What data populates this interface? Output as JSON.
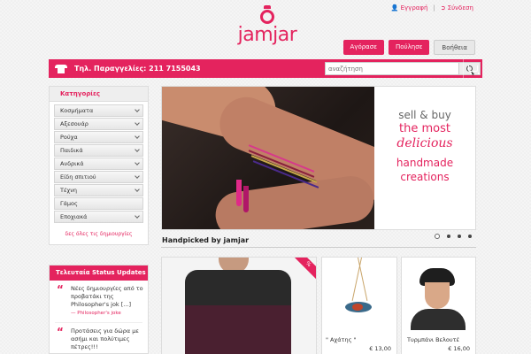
{
  "header": {
    "register": "Εγγραφή",
    "login": "Σύνδεση",
    "brand": "jamjar",
    "buttons": {
      "buy": "Αγόρασε",
      "sell": "Πούλησε",
      "help": "Βοήθεια"
    }
  },
  "bar": {
    "phone_text": "Τηλ. Παραγγελίες: 211 7155043",
    "search_placeholder": "αναζήτηση"
  },
  "sidebar": {
    "title": "Κατηγορίες",
    "items": [
      "Κοσμήματα",
      "Αξεσουάρ",
      "Ρούχα",
      "Παιδικά",
      "Ανδρικά",
      "Είδη σπιτιού",
      "Τέχνη",
      "Γάμος",
      "Εποχιακά"
    ],
    "see_all": "δες όλες τις δημιουργίες"
  },
  "status": {
    "title": "Τελευταία Status Updates",
    "updates": [
      {
        "text": "Νέες δημιουργίες από το προβατάκι της Philosopher's jok [...]",
        "source": "Philosopher's joke"
      },
      {
        "text": "Προτάσεις για δώρα με ασήμι και πολύτιμες πέτρες!!!",
        "source": ""
      }
    ]
  },
  "banner": {
    "line1": "sell & buy",
    "line2": "the most",
    "line3": "delicious",
    "line4": "handmade",
    "line5": "creations"
  },
  "section_title": "Handpicked by jamjar",
  "products": [
    {
      "name": "",
      "price": "",
      "ribbon": "%"
    },
    {
      "name": "\" Αχάτης \"",
      "price": "€ 13,00"
    },
    {
      "name": "Τυρμπάνι Βελουτέ",
      "price": "€ 16,00"
    }
  ],
  "colors": {
    "accent": "#e4235e"
  }
}
